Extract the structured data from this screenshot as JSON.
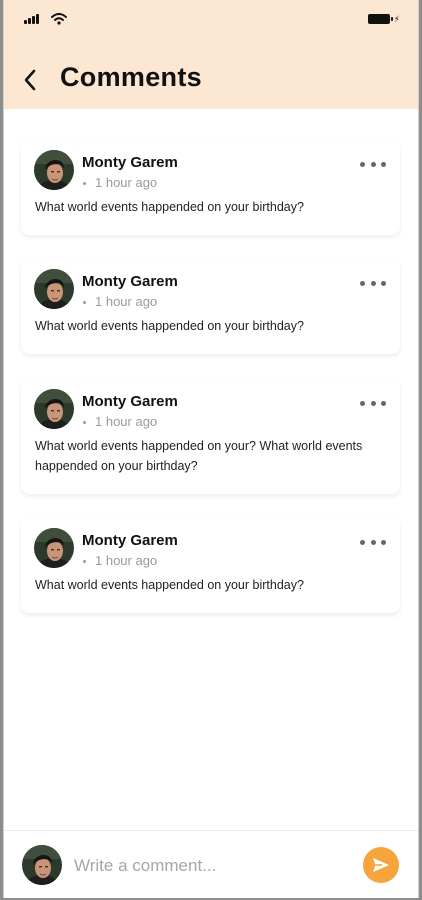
{
  "header": {
    "title": "Comments"
  },
  "icons": {
    "back": "chevron-left-icon",
    "more": "more-horizontal-icon",
    "send": "send-icon"
  },
  "colors": {
    "header_bg": "#fbe7d2",
    "accent": "#f6a53c"
  },
  "comments": [
    {
      "author": "Monty Garem",
      "time": "1 hour ago",
      "text": "What world events happended on your birthday?"
    },
    {
      "author": "Monty Garem",
      "time": "1 hour ago",
      "text": "What world events happended on your birthday?"
    },
    {
      "author": "Monty Garem",
      "time": "1 hour ago",
      "text": "What world events happended on your? What world events happended on your birthday?"
    },
    {
      "author": "Monty Garem",
      "time": "1 hour ago",
      "text": "What world events happended on your birthday?"
    }
  ],
  "composer": {
    "placeholder": "Write a comment..."
  }
}
